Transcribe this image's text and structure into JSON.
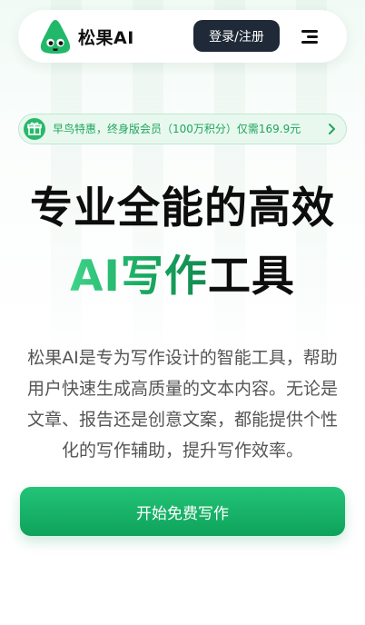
{
  "header": {
    "brand": "松果AI",
    "login_label": "登录/注册"
  },
  "promo": {
    "text": "早鸟特惠，终身版会员（100万积分）仅需169.9元"
  },
  "hero": {
    "line1": "专业全能的高效",
    "line2_accent": "AI写作",
    "line2_rest": "工具"
  },
  "description": "松果AI是专为写作设计的智能工具，帮助用户快速生成高质量的文本内容。无论是文章、报告还是创意文案，都能提供个性化的写作辅助，提升写作效率。",
  "cta": {
    "label": "开始免费写作"
  },
  "colors": {
    "brand_green": "#1db16a",
    "dark_button": "#1f2937",
    "promo_bg": "#e9f8ef"
  },
  "icons": {
    "logo": "pine-cone-mascot-icon",
    "menu": "hamburger-menu-icon",
    "gift": "gift-icon",
    "chevron": "chevron-right-icon"
  }
}
